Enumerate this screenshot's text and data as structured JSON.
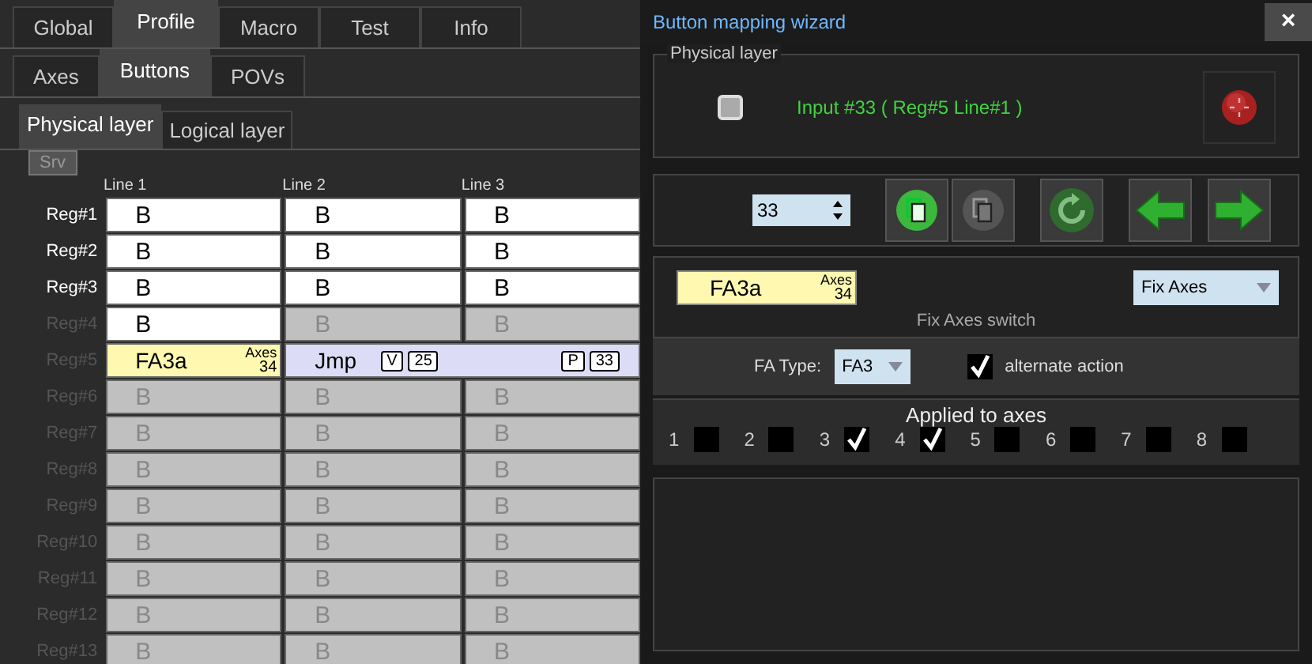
{
  "main_tabs": [
    {
      "label": "Global",
      "selected": false
    },
    {
      "label": "Profile",
      "selected": true
    },
    {
      "label": "Macro",
      "selected": false
    },
    {
      "label": "Test",
      "selected": false
    },
    {
      "label": "Info",
      "selected": false
    }
  ],
  "sub_tabs": [
    {
      "label": "Axes",
      "selected": false
    },
    {
      "label": "Buttons",
      "selected": true
    },
    {
      "label": "POVs",
      "selected": false
    }
  ],
  "layer_tabs": [
    {
      "label": "Physical layer",
      "selected": true
    },
    {
      "label": "Logical layer",
      "selected": false
    }
  ],
  "srv_button": "Srv",
  "columns": [
    "Line 1",
    "Line 2",
    "Line 3"
  ],
  "rows": [
    {
      "label": "Reg#1",
      "enabled": true,
      "cells": [
        {
          "kind": "button",
          "text": "B",
          "enabled": true
        },
        {
          "kind": "button",
          "text": "B",
          "enabled": true
        },
        {
          "kind": "button",
          "text": "B",
          "enabled": true
        }
      ]
    },
    {
      "label": "Reg#2",
      "enabled": true,
      "cells": [
        {
          "kind": "button",
          "text": "B",
          "enabled": true
        },
        {
          "kind": "button",
          "text": "B",
          "enabled": true
        },
        {
          "kind": "button",
          "text": "B",
          "enabled": true
        }
      ]
    },
    {
      "label": "Reg#3",
      "enabled": true,
      "cells": [
        {
          "kind": "button",
          "text": "B",
          "enabled": true
        },
        {
          "kind": "button",
          "text": "B",
          "enabled": true
        },
        {
          "kind": "button",
          "text": "B",
          "enabled": true
        }
      ]
    },
    {
      "label": "Reg#4",
      "enabled": false,
      "cells": [
        {
          "kind": "button",
          "text": "B",
          "enabled": true
        },
        {
          "kind": "button",
          "text": "B",
          "enabled": false
        },
        {
          "kind": "button",
          "text": "B",
          "enabled": false
        }
      ]
    },
    {
      "label": "Reg#5",
      "enabled": false,
      "cells": [
        {
          "kind": "fix_axes",
          "text": "FA3a",
          "caption": "Axes",
          "number": "34"
        },
        {
          "kind": "jump",
          "text": "Jmp",
          "tags": [
            "V",
            "25"
          ],
          "end_tags": [
            "P",
            "33"
          ]
        }
      ]
    },
    {
      "label": "Reg#6",
      "enabled": false,
      "cells": [
        {
          "kind": "button",
          "text": "B",
          "enabled": false
        },
        {
          "kind": "button",
          "text": "B",
          "enabled": false
        },
        {
          "kind": "button",
          "text": "B",
          "enabled": false
        }
      ]
    },
    {
      "label": "Reg#7",
      "enabled": false,
      "cells": [
        {
          "kind": "button",
          "text": "B",
          "enabled": false
        },
        {
          "kind": "button",
          "text": "B",
          "enabled": false
        },
        {
          "kind": "button",
          "text": "B",
          "enabled": false
        }
      ]
    },
    {
      "label": "Reg#8",
      "enabled": false,
      "cells": [
        {
          "kind": "button",
          "text": "B",
          "enabled": false
        },
        {
          "kind": "button",
          "text": "B",
          "enabled": false
        },
        {
          "kind": "button",
          "text": "B",
          "enabled": false
        }
      ]
    },
    {
      "label": "Reg#9",
      "enabled": false,
      "cells": [
        {
          "kind": "button",
          "text": "B",
          "enabled": false
        },
        {
          "kind": "button",
          "text": "B",
          "enabled": false
        },
        {
          "kind": "button",
          "text": "B",
          "enabled": false
        }
      ]
    },
    {
      "label": "Reg#10",
      "enabled": false,
      "cells": [
        {
          "kind": "button",
          "text": "B",
          "enabled": false
        },
        {
          "kind": "button",
          "text": "B",
          "enabled": false
        },
        {
          "kind": "button",
          "text": "B",
          "enabled": false
        }
      ]
    },
    {
      "label": "Reg#11",
      "enabled": false,
      "cells": [
        {
          "kind": "button",
          "text": "B",
          "enabled": false
        },
        {
          "kind": "button",
          "text": "B",
          "enabled": false
        },
        {
          "kind": "button",
          "text": "B",
          "enabled": false
        }
      ]
    },
    {
      "label": "Reg#12",
      "enabled": false,
      "cells": [
        {
          "kind": "button",
          "text": "B",
          "enabled": false
        },
        {
          "kind": "button",
          "text": "B",
          "enabled": false
        },
        {
          "kind": "button",
          "text": "B",
          "enabled": false
        }
      ]
    },
    {
      "label": "Reg#13",
      "enabled": false,
      "cells": [
        {
          "kind": "button",
          "text": "B",
          "enabled": false
        },
        {
          "kind": "button",
          "text": "B",
          "enabled": false
        },
        {
          "kind": "button",
          "text": "B",
          "enabled": false
        }
      ]
    }
  ],
  "wizard": {
    "title": "Button mapping wizard",
    "close": "×",
    "group_title": "Physical layer",
    "input_checked": false,
    "input_text": "Input #33  ( Reg#5   Line#1 )",
    "spin_value": "33",
    "tools": [
      {
        "kind": "copy",
        "enabled": true
      },
      {
        "kind": "paste",
        "enabled": false
      },
      {
        "kind": "reset",
        "enabled": false
      },
      {
        "kind": "prev",
        "enabled": true
      },
      {
        "kind": "next",
        "enabled": true
      }
    ],
    "chip": {
      "text": "FA3a",
      "caption": "Axes",
      "number": "34"
    },
    "function_select": "Fix Axes",
    "function_caption": "Fix Axes switch",
    "fa_type_label": "FA Type:",
    "fa_type": "FA3",
    "alternate": {
      "label": "alternate action",
      "checked": true
    },
    "axes_title": "Applied to axes",
    "axes": [
      {
        "label": "1",
        "checked": false
      },
      {
        "label": "2",
        "checked": false
      },
      {
        "label": "3",
        "checked": true
      },
      {
        "label": "4",
        "checked": true
      },
      {
        "label": "5",
        "checked": false
      },
      {
        "label": "6",
        "checked": false
      },
      {
        "label": "7",
        "checked": false
      },
      {
        "label": "8",
        "checked": false
      }
    ]
  }
}
